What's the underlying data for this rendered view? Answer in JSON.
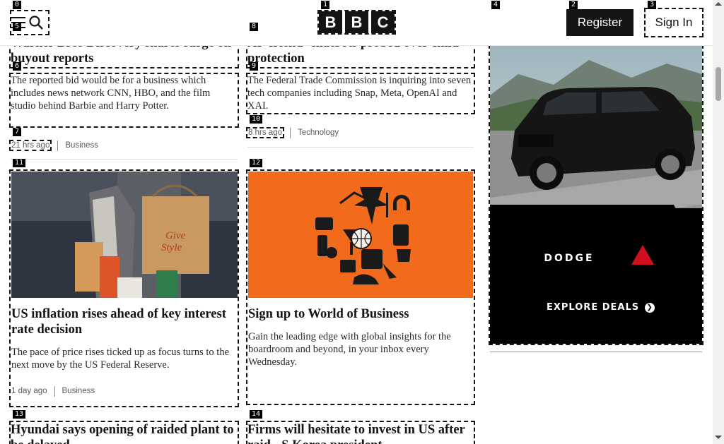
{
  "header": {
    "logo_letters": [
      "B",
      "B",
      "C"
    ],
    "register_label": "Register",
    "signin_label": "Sign In"
  },
  "markers": [
    "0",
    "1",
    "2",
    "3",
    "4",
    "5",
    "6",
    "7",
    "8",
    "9",
    "10",
    "11",
    "12",
    "13",
    "14"
  ],
  "articles": [
    {
      "headline": "Warner Bros Discovery shares surge on buyout reports",
      "summary": "The reported bid would be for a business which includes news network CNN, HBO, and the film studio behind Barbie and Harry Potter.",
      "time": "21 hrs ago",
      "category": "Business"
    },
    {
      "headline": "AI 'friend' chatbots probed over child protection",
      "summary": "The Federal Trade Commission is inquiring into seven tech companies including Snap, Meta, OpenAI and XAI.",
      "time": "8 hrs ago",
      "category": "Technology"
    },
    {
      "headline": "US inflation rises ahead of key interest rate decision",
      "summary": "The pace of price rises ticked up as focus turns to the next move by the US Federal Reserve.",
      "time": "1 day ago",
      "category": "Business"
    },
    {
      "headline": "Sign up to World of Business",
      "summary": "Gain the leading edge with global insights for the boardroom and beyond, in your inbox every Wednesday."
    },
    {
      "headline": "Hyundai says opening of raided plant to be delayed"
    },
    {
      "headline": "Firms will hesitate to invest in US after raid - S Korea president"
    }
  ],
  "ad": {
    "brand": "DODGE",
    "cta": "EXPLORE DEALS"
  },
  "colors": {
    "ink": "#141414",
    "promo_orange": "#f26a1b",
    "ad_black": "#000000"
  }
}
